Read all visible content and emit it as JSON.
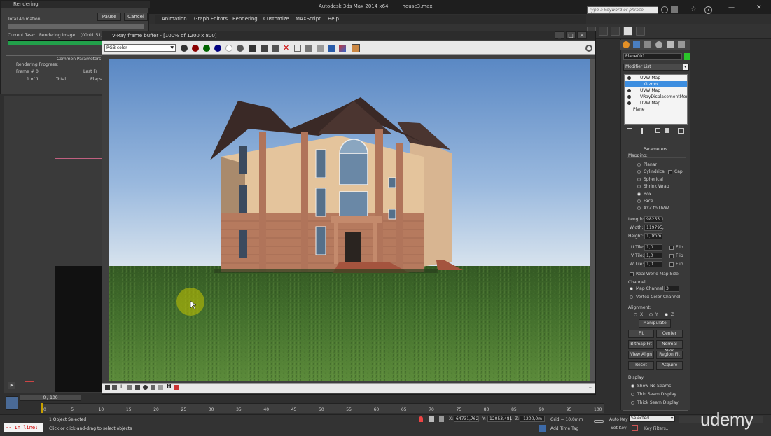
{
  "app": {
    "title": "Autodesk 3ds Max 2014 x64",
    "file": "house3.max",
    "search_placeholder": "Type a keyword or phrase",
    "menus": [
      "Animation",
      "Graph Editors",
      "Rendering",
      "Customize",
      "MAXScript",
      "Help"
    ]
  },
  "rendering_dialog": {
    "title": "Rendering",
    "total_animation": "Total Animation:",
    "current_task_label": "Current Task:",
    "current_task_value": "Rendering image... [00:01:51,2",
    "pause": "Pause",
    "cancel": "Cancel",
    "common_parameters": "Common Parameters",
    "rendering_progress": "Rendering Progress:",
    "frame_label": "Frame #",
    "frame_value": "0",
    "of": "1 of 1",
    "total": "Total",
    "last_frame": "Last Fr",
    "elapsed": "Elaps",
    "progress": 0.99
  },
  "vfb": {
    "title": "V-Ray frame buffer - [100% of 1200 x 800]",
    "channel": "RGB color"
  },
  "command_panel": {
    "object_name": "Plane001",
    "modifier_list": "Modifier List",
    "stack": [
      "UVW Map",
      "Gizmo",
      "UVW Map",
      "VRayDisplacementMod",
      "UVW Map",
      "Plane"
    ],
    "parameters_title": "Parameters",
    "mapping_label": "Mapping:",
    "mapping_options": [
      "Planar",
      "Cylindrical",
      "Spherical",
      "Shrink Wrap",
      "Box",
      "Face",
      "XYZ to UVW"
    ],
    "cap": "Cap",
    "length_label": "Length:",
    "length_value": "98255,1",
    "width_label": "Width:",
    "width_value": "119795,",
    "height_label": "Height:",
    "height_value": "1,0mm",
    "utile_label": "U Tile:",
    "utile_value": "1,0",
    "vtile_label": "V Tile:",
    "vtile_value": "1,0",
    "wtile_label": "W Tile:",
    "wtile_value": "1,0",
    "flip": "Flip",
    "real_world": "Real-World Map Size",
    "channel_label": "Channel:",
    "map_channel": "Map Channel:",
    "map_channel_value": "3",
    "vertex_color": "Vertex Color Channel",
    "alignment_label": "Alignment:",
    "axes": [
      "X",
      "Y",
      "Z"
    ],
    "manipulate": "Manipulate",
    "fit": "Fit",
    "center": "Center",
    "bitmap_fit": "Bitmap Fit",
    "normal_align": "Normal Align",
    "view_align": "View Align",
    "region_fit": "Region Fit",
    "reset": "Reset",
    "acquire": "Acquire",
    "display_label": "Display:",
    "display_options": [
      "Show No Seams",
      "Thin Seam Display",
      "Thick Seam Display"
    ]
  },
  "status": {
    "frame_slider": "0 / 100",
    "ticks": [
      "0",
      "5",
      "10",
      "15",
      "20",
      "25",
      "30",
      "35",
      "40",
      "45",
      "50",
      "55",
      "60",
      "65",
      "70",
      "75",
      "80",
      "85",
      "90",
      "95",
      "100"
    ],
    "selected": "1 Object Selected",
    "prompt": "Click or click-and-drag to select objects",
    "maxscript": "-- In line:",
    "x_label": "X:",
    "x_value": "64731,762",
    "y_label": "Y:",
    "y_value": "12053,481",
    "z_label": "Z:",
    "z_value": "-1200,0m",
    "grid": "Grid = 10,0mm",
    "add_time_tag": "Add Time Tag",
    "auto_key": "Auto Key",
    "set_key": "Set Key",
    "selected_dropdown": "Selected",
    "key_filters": "Key Filters...",
    "watermark": "udemy"
  },
  "colors": {
    "accent": "#3d8ee0",
    "progress": "#21a04a",
    "grass": "#3e6a2a",
    "sky": "#8fb0d6"
  }
}
